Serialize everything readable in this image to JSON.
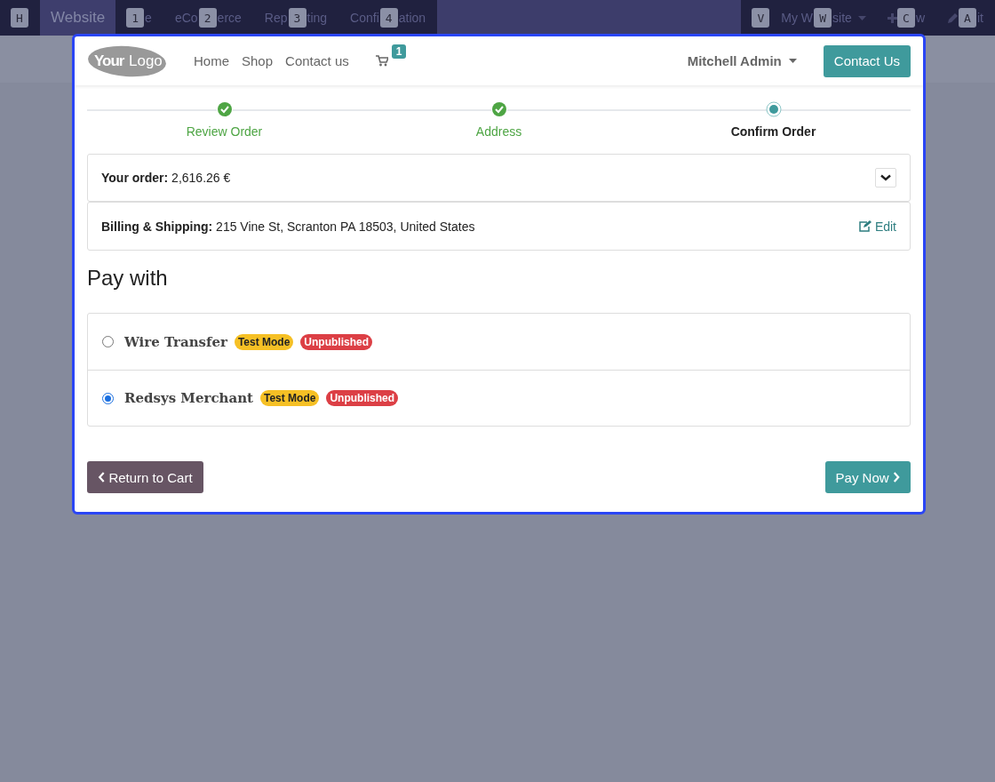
{
  "top_bar": {
    "app_hint": "H",
    "app_name": "Website",
    "menu": [
      {
        "hint": "1",
        "after": "e"
      },
      {
        "before": "eCo",
        "hint": "2",
        "after": "erce"
      },
      {
        "before": "Rep",
        "hint": "3",
        "after": "ting"
      },
      {
        "before": "Confi",
        "hint": "4",
        "after": "ation"
      }
    ],
    "right": [
      {
        "kind": "plain",
        "lead_hint": "V",
        "before": "My W",
        "hint": "W",
        "after": "site",
        "caret": true
      },
      {
        "kind": "plus",
        "hint": "C",
        "after": "w",
        "caret": false
      },
      {
        "kind": "pencil",
        "hint": "A",
        "after": "it",
        "caret": false
      }
    ]
  },
  "header": {
    "logo": {
      "first": "Your",
      "second": "Logo"
    },
    "nav": [
      "Home",
      "Shop",
      "Contact us"
    ],
    "cart_count": "1",
    "user": "Mitchell Admin",
    "cta": "Contact Us"
  },
  "steps": [
    {
      "label": "Review Order",
      "kind": "done"
    },
    {
      "label": "Address",
      "kind": "done"
    },
    {
      "label": "Confirm Order",
      "kind": "current"
    }
  ],
  "order": {
    "label": "Your order:",
    "total": "2,616.26 €"
  },
  "billing": {
    "label": "Billing & Shipping:",
    "address": "215 Vine St, Scranton PA 18503, United States",
    "edit": "Edit"
  },
  "pay_with": {
    "title": "Pay with",
    "methods": [
      {
        "name": "Wire Transfer",
        "selected": false,
        "badges": [
          {
            "text": "Test Mode",
            "color": "#f6c025"
          },
          {
            "text": "Unpublished",
            "color": "#dc3f45"
          }
        ]
      },
      {
        "name": "Redsys Merchant",
        "selected": true,
        "badges": [
          {
            "text": "Test Mode",
            "color": "#f6c025"
          },
          {
            "text": "Unpublished",
            "color": "#dc3f45"
          }
        ]
      }
    ]
  },
  "buttons": {
    "back": "Return to Cart",
    "pay": "Pay Now"
  }
}
